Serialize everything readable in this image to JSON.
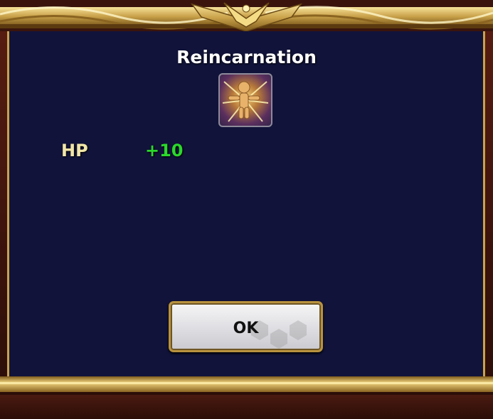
{
  "dialog": {
    "title": "Reincarnation",
    "icon": "reincarnation-skill-icon",
    "stats": [
      {
        "label": "HP",
        "value": "+10"
      }
    ],
    "ok_label": "OK"
  },
  "colors": {
    "panel": "#11133a",
    "gold": "#c9a24a",
    "stat_label": "#f2e6a8",
    "stat_value": "#2bd82b"
  }
}
